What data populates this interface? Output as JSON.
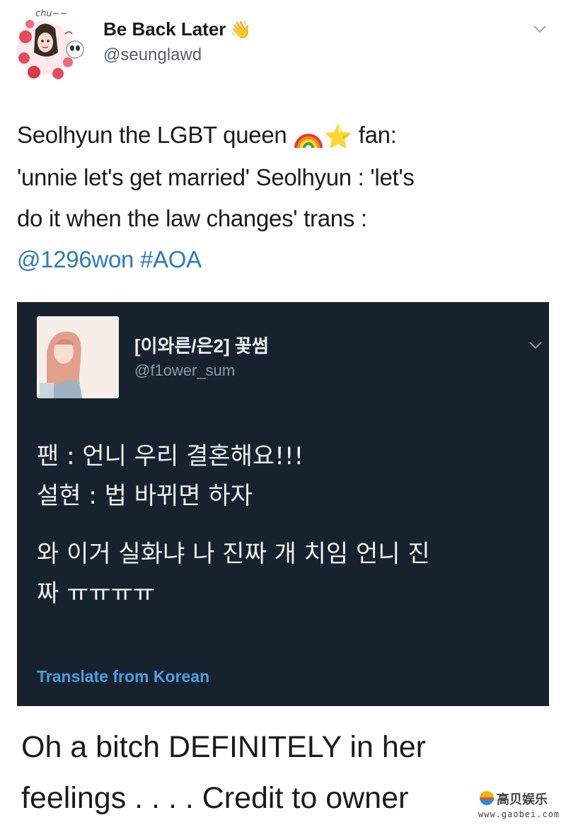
{
  "tweet": {
    "avatar_scribble": "chu~~",
    "display_name": "Be Back Later",
    "wave_emoji": "👋",
    "handle": "@seunglawd",
    "body": {
      "line1_text": "Seolhyun the LGBT queen ",
      "line1_emoji_star": "⭐",
      "line1_tail": " fan:",
      "line2": "'unnie let's get married'  Seolhyun : 'let's",
      "line3": "do it when the law changes'  trans :",
      "mention": "@1296won",
      "hashtag": "#AOA"
    },
    "icons": [
      "wave-emoji",
      "rainbow-emoji",
      "star-emoji",
      "chevron-down-icon"
    ]
  },
  "quoted_tweet": {
    "display_name": "[이와른/은2] 꽃썸",
    "handle": "@f1ower_sum",
    "lines": [
      "팬 : 언니 우리 결혼해요!!!",
      "설현 : 법 바뀌면 하자",
      "와 이거 실화냐 나 진짜 개 치임 언니 진",
      "짜 ㅠㅠㅠㅠ"
    ],
    "translate_label": "Translate from Korean",
    "background": "#18222e"
  },
  "caption": {
    "line1": "Oh a bitch DEFINITELY in her",
    "line2": "feelings . . . . Credit to owner"
  },
  "watermark": {
    "brand_text": "高贝娱乐",
    "url": "www.gaobei.com"
  },
  "colors": {
    "link": "#2b7bbd",
    "translate_link": "#4a9fe0",
    "handle_gray": "#555e66"
  }
}
